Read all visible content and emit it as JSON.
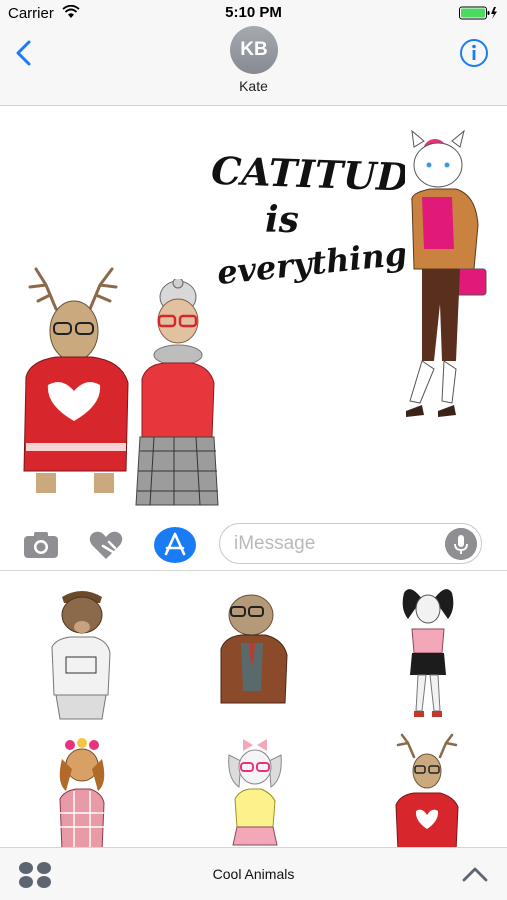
{
  "status_bar": {
    "carrier": "Carrier",
    "time": "5:10 PM"
  },
  "header": {
    "avatar_initials": "KB",
    "contact_name": "Kate"
  },
  "conversation": {
    "text_sticker": {
      "line1": "CATITUDE",
      "line2": "is",
      "line3": "everything"
    }
  },
  "input": {
    "placeholder": "iMessage"
  },
  "bottom_bar": {
    "pack_title": "Cool Animals"
  },
  "colors": {
    "accent": "#1a7cf5",
    "sweater_red": "#d8272c",
    "battery_green": "#4cd964"
  }
}
